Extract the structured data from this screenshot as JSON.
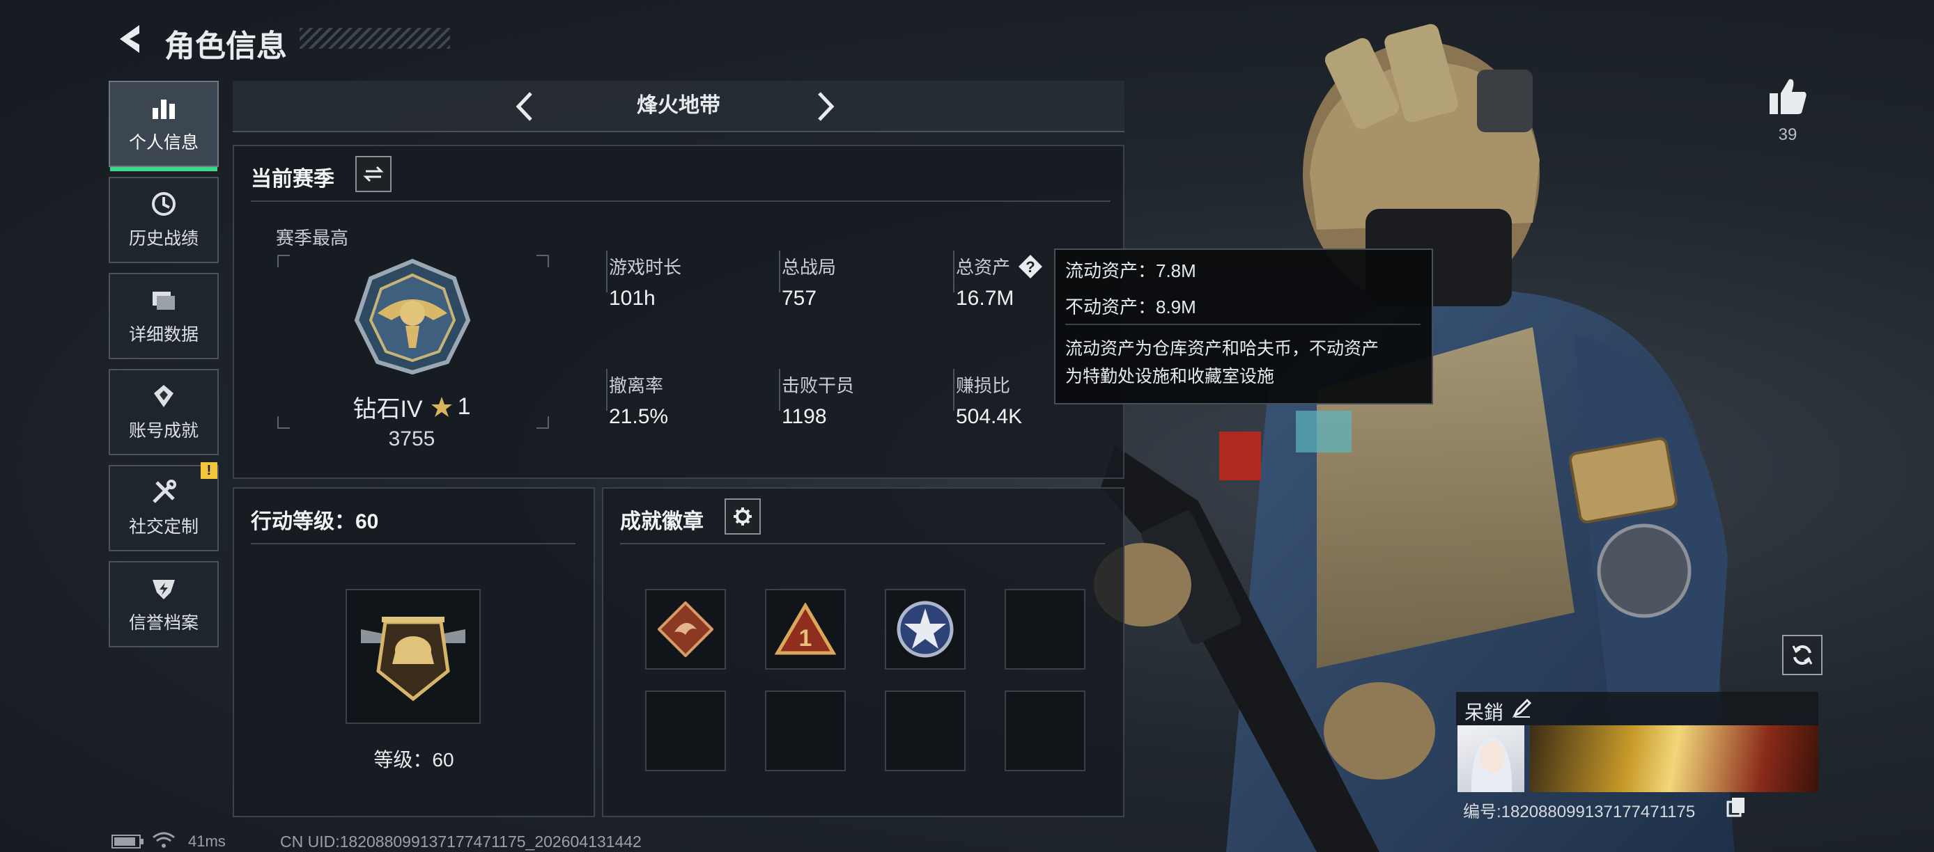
{
  "header": {
    "title": "角色信息"
  },
  "sidebar": {
    "items": [
      {
        "label": "个人信息",
        "icon": "bar-chart-icon",
        "active": true
      },
      {
        "label": "历史战绩",
        "icon": "clock-icon"
      },
      {
        "label": "详细数据",
        "icon": "folders-icon"
      },
      {
        "label": "账号成就",
        "icon": "achievement-icon"
      },
      {
        "label": "社交定制",
        "icon": "tools-icon",
        "badge": "!"
      },
      {
        "label": "信誉档案",
        "icon": "shield-bolt-icon"
      }
    ]
  },
  "mode_selector": {
    "label": "烽火地带"
  },
  "season": {
    "header": "当前赛季",
    "best_label": "赛季最高",
    "rank_name": "钻石IV",
    "rank_stars": "1",
    "rank_score": "3755",
    "stats": [
      {
        "label": "游戏时长",
        "value": "101h"
      },
      {
        "label": "总战局",
        "value": "757"
      },
      {
        "label": "总资产",
        "value": "16.7M"
      },
      {
        "label": "撤离率",
        "value": "21.5%"
      },
      {
        "label": "击败干员",
        "value": "1198"
      },
      {
        "label": "赚损比",
        "value": "504.4K"
      }
    ]
  },
  "tooltip": {
    "line1": "流动资产：7.8M",
    "line2": "不动资产：8.9M",
    "desc1": "流动资产为仓库资产和哈夫币，不动资产",
    "desc2": "为特勤处设施和收藏室设施"
  },
  "action_level": {
    "header": "行动等级：60",
    "level_text": "等级：60"
  },
  "badges": {
    "header": "成就徽章",
    "filled": [
      "dragon-badge",
      "number-one-badge",
      "star-shield-badge"
    ]
  },
  "likes": {
    "count": "39"
  },
  "profile": {
    "name": "呆銷",
    "uid_label": "编号:1820880991371774711​75"
  },
  "status_bar": {
    "ping": "41ms",
    "uid": "CN UID:1820880991371774711​75_202604131442"
  },
  "colors": {
    "accent_green": "#39d98a",
    "badge_yellow": "#f3c53b",
    "gold": "#c9a45a"
  }
}
